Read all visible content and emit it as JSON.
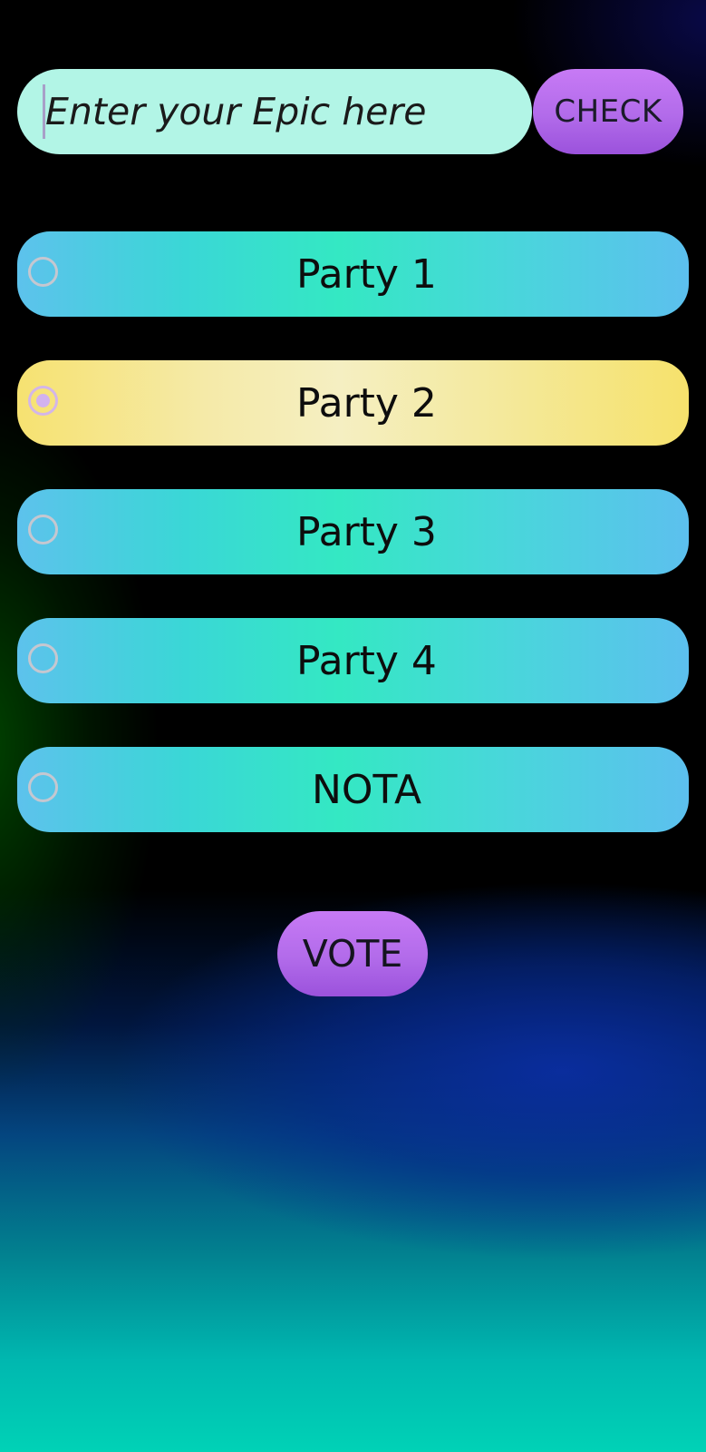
{
  "epic_input": {
    "placeholder": "Enter your Epic here",
    "value": ""
  },
  "check_button": {
    "label": "CHECK"
  },
  "options": [
    {
      "label": "Party 1",
      "selected": false
    },
    {
      "label": "Party 2",
      "selected": true
    },
    {
      "label": "Party 3",
      "selected": false
    },
    {
      "label": "Party 4",
      "selected": false
    },
    {
      "label": "NOTA",
      "selected": false
    }
  ],
  "vote_button": {
    "label": "VOTE"
  },
  "colors": {
    "option_default": "#3ee3c8",
    "option_selected": "#f5e890",
    "button_accent": "#b26bea",
    "input_background": "#b2f5e6"
  }
}
